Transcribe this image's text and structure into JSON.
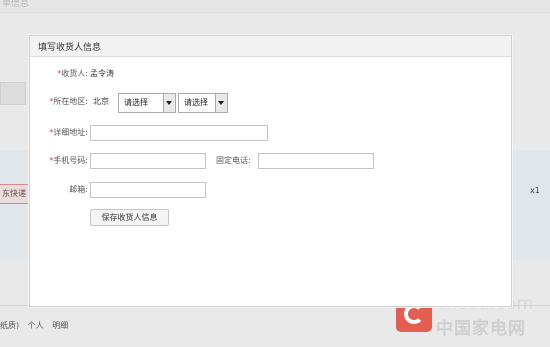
{
  "background": {
    "top_text": "单信息",
    "express_label": "东快递",
    "quantity": "x1",
    "bottom_items": [
      "纸质)",
      "个人",
      "明细"
    ]
  },
  "watermark": {
    "en": "cheaa.com",
    "cn": "中国家电网"
  },
  "modal": {
    "title": "填写收货人信息",
    "required_mark": "*",
    "receiver": {
      "label": "收货人:",
      "value": "孟令涛"
    },
    "region": {
      "label": "所在地区:",
      "province": "北京",
      "city_select": "请选择",
      "district_select": "请选择"
    },
    "address": {
      "label": "详细地址:",
      "value": ""
    },
    "mobile": {
      "label": "手机号码:",
      "value": ""
    },
    "phone": {
      "label": "固定电话:",
      "value": ""
    },
    "email": {
      "label": "邮箱:",
      "value": ""
    },
    "save_label": "保存收货人信息"
  }
}
